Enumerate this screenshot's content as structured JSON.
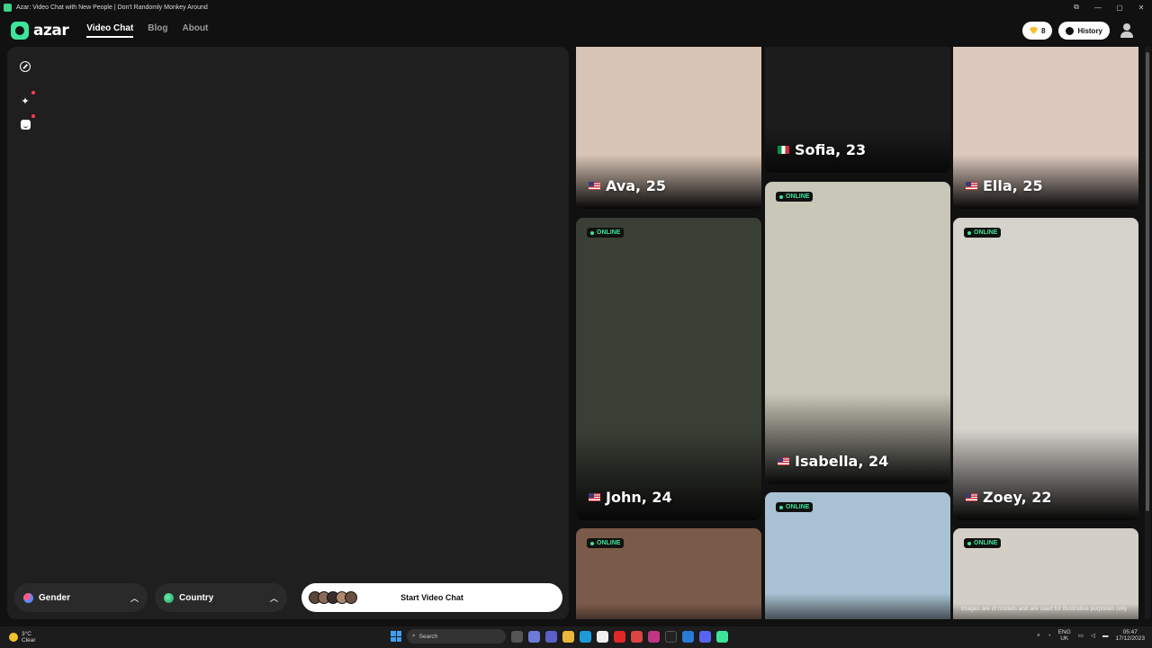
{
  "window": {
    "title": "Azar: Video Chat with New People | Don't Randomly Monkey Around",
    "controls": [
      "⧉",
      "—",
      "▢",
      "✕"
    ]
  },
  "header": {
    "logo_text": "azar",
    "nav": [
      "Video Chat",
      "Blog",
      "About"
    ],
    "gems": "8",
    "history_label": "History"
  },
  "controls": {
    "gender_label": "Gender",
    "country_label": "Country",
    "start_label": "Start Video Chat"
  },
  "cards": [
    {
      "name": "Ava, 25",
      "flag": "us",
      "online": false,
      "bg": "#d8c4b4"
    },
    {
      "name": "Sofia, 23",
      "flag": "it",
      "online": false,
      "bg": "#1c1c1c"
    },
    {
      "name": "Ella, 25",
      "flag": "us",
      "online": false,
      "bg": "#dcc9bd"
    },
    {
      "name": "John, 24",
      "flag": "us",
      "online": true,
      "bg": "#3a3f35"
    },
    {
      "name": "Isabella, 24",
      "flag": "us",
      "online": true,
      "bg": "#c8c7b8"
    },
    {
      "name": "Zoey, 22",
      "flag": "us",
      "online": true,
      "bg": "#d6d2cc"
    },
    {
      "name": "",
      "flag": "",
      "online": true,
      "bg": "#7a5a48"
    },
    {
      "name": "",
      "flag": "",
      "online": true,
      "bg": "#a9c2d3"
    },
    {
      "name": "",
      "flag": "",
      "online": true,
      "bg": "#d4cfc6"
    }
  ],
  "online_badge": "ONLINE",
  "disclaimer": "Images are of models and are used for illustrative purposes only",
  "taskbar": {
    "weather_temp": "3°C",
    "weather_desc": "Clear",
    "search_placeholder": "Search",
    "lang_top": "ENG",
    "lang_bottom": "UK",
    "time": "05:47",
    "date": "17/12/2023"
  },
  "colors": {
    "accent": "#3ee49a",
    "panel": "#1f1f1f",
    "background": "#111111"
  }
}
